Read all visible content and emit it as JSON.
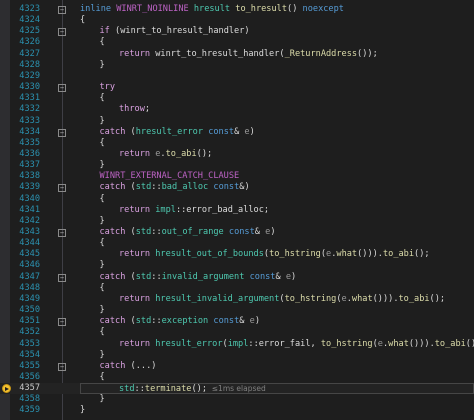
{
  "colors": {
    "keyword": "#569cd6",
    "control": "#d8a0df",
    "function": "#dcdcaa",
    "type": "#4ec9b0",
    "macro": "#bd63c5",
    "param": "#9a9a9a",
    "plain": "#dcdcdc",
    "line_number": "#2b91af"
  },
  "icons": {
    "fold_collapse": "−",
    "current_statement": "current-statement-arrow-icon"
  },
  "current_line": "4357",
  "perf_tip": "≤1ms elapsed",
  "lines": [
    {
      "num": "4323",
      "fold": true,
      "indent": 0,
      "tokens": [
        [
          "inline",
          "keyword"
        ],
        [
          " ",
          "plain"
        ],
        [
          "WINRT_NOINLINE",
          "macro"
        ],
        [
          " ",
          "plain"
        ],
        [
          "hresult",
          "type"
        ],
        [
          " ",
          "plain"
        ],
        [
          "to_hresult",
          "function"
        ],
        [
          "() ",
          "plain"
        ],
        [
          "noexcept",
          "keyword"
        ]
      ]
    },
    {
      "num": "4324",
      "fold": false,
      "indent": 0,
      "tokens": [
        [
          "{",
          "plain"
        ]
      ]
    },
    {
      "num": "4325",
      "fold": true,
      "indent": 1,
      "tokens": [
        [
          "if",
          "control"
        ],
        [
          " (",
          "plain"
        ],
        [
          "winrt_to_hresult_handler",
          "plain"
        ],
        [
          ")",
          "plain"
        ]
      ]
    },
    {
      "num": "4326",
      "fold": false,
      "indent": 1,
      "tokens": [
        [
          "{",
          "plain"
        ]
      ]
    },
    {
      "num": "4327",
      "fold": false,
      "indent": 2,
      "tokens": [
        [
          "return",
          "control"
        ],
        [
          " ",
          "plain"
        ],
        [
          "winrt_to_hresult_handler",
          "plain"
        ],
        [
          "(",
          "plain"
        ],
        [
          "_ReturnAddress",
          "function"
        ],
        [
          "());",
          "plain"
        ]
      ]
    },
    {
      "num": "4328",
      "fold": false,
      "indent": 1,
      "tokens": [
        [
          "}",
          "plain"
        ]
      ]
    },
    {
      "num": "4329",
      "fold": false,
      "indent": 0,
      "tokens": []
    },
    {
      "num": "4330",
      "fold": true,
      "indent": 1,
      "tokens": [
        [
          "try",
          "control"
        ]
      ]
    },
    {
      "num": "4331",
      "fold": false,
      "indent": 1,
      "tokens": [
        [
          "{",
          "plain"
        ]
      ]
    },
    {
      "num": "4332",
      "fold": false,
      "indent": 2,
      "tokens": [
        [
          "throw",
          "control"
        ],
        [
          ";",
          "plain"
        ]
      ]
    },
    {
      "num": "4333",
      "fold": false,
      "indent": 1,
      "tokens": [
        [
          "}",
          "plain"
        ]
      ]
    },
    {
      "num": "4334",
      "fold": true,
      "indent": 1,
      "tokens": [
        [
          "catch",
          "control"
        ],
        [
          " (",
          "plain"
        ],
        [
          "hresult_error",
          "type"
        ],
        [
          " ",
          "plain"
        ],
        [
          "const",
          "keyword"
        ],
        [
          "& ",
          "plain"
        ],
        [
          "e",
          "param"
        ],
        [
          ")",
          "plain"
        ]
      ]
    },
    {
      "num": "4335",
      "fold": false,
      "indent": 1,
      "tokens": [
        [
          "{",
          "plain"
        ]
      ]
    },
    {
      "num": "4336",
      "fold": false,
      "indent": 2,
      "tokens": [
        [
          "return",
          "control"
        ],
        [
          " ",
          "plain"
        ],
        [
          "e",
          "param"
        ],
        [
          ".",
          "plain"
        ],
        [
          "to_abi",
          "function"
        ],
        [
          "();",
          "plain"
        ]
      ]
    },
    {
      "num": "4337",
      "fold": false,
      "indent": 1,
      "tokens": [
        [
          "}",
          "plain"
        ]
      ]
    },
    {
      "num": "4338",
      "fold": false,
      "indent": 1,
      "tokens": [
        [
          "WINRT_EXTERNAL_CATCH_CLAUSE",
          "macro"
        ]
      ]
    },
    {
      "num": "4339",
      "fold": true,
      "indent": 1,
      "tokens": [
        [
          "catch",
          "control"
        ],
        [
          " (",
          "plain"
        ],
        [
          "std",
          "type"
        ],
        [
          "::",
          "plain"
        ],
        [
          "bad_alloc",
          "type"
        ],
        [
          " ",
          "plain"
        ],
        [
          "const",
          "keyword"
        ],
        [
          "&)",
          "plain"
        ]
      ]
    },
    {
      "num": "4340",
      "fold": false,
      "indent": 1,
      "tokens": [
        [
          "{",
          "plain"
        ]
      ]
    },
    {
      "num": "4341",
      "fold": false,
      "indent": 2,
      "tokens": [
        [
          "return",
          "control"
        ],
        [
          " ",
          "plain"
        ],
        [
          "impl",
          "type"
        ],
        [
          "::",
          "plain"
        ],
        [
          "error_bad_alloc",
          "plain"
        ],
        [
          ";",
          "plain"
        ]
      ]
    },
    {
      "num": "4342",
      "fold": false,
      "indent": 1,
      "tokens": [
        [
          "}",
          "plain"
        ]
      ]
    },
    {
      "num": "4343",
      "fold": true,
      "indent": 1,
      "tokens": [
        [
          "catch",
          "control"
        ],
        [
          " (",
          "plain"
        ],
        [
          "std",
          "type"
        ],
        [
          "::",
          "plain"
        ],
        [
          "out_of_range",
          "type"
        ],
        [
          " ",
          "plain"
        ],
        [
          "const",
          "keyword"
        ],
        [
          "& ",
          "plain"
        ],
        [
          "e",
          "param"
        ],
        [
          ")",
          "plain"
        ]
      ]
    },
    {
      "num": "4344",
      "fold": false,
      "indent": 1,
      "tokens": [
        [
          "{",
          "plain"
        ]
      ]
    },
    {
      "num": "4345",
      "fold": false,
      "indent": 2,
      "tokens": [
        [
          "return",
          "control"
        ],
        [
          " ",
          "plain"
        ],
        [
          "hresult_out_of_bounds",
          "type"
        ],
        [
          "(",
          "plain"
        ],
        [
          "to_hstring",
          "function"
        ],
        [
          "(",
          "plain"
        ],
        [
          "e",
          "param"
        ],
        [
          ".",
          "plain"
        ],
        [
          "what",
          "function"
        ],
        [
          "())).",
          "plain"
        ],
        [
          "to_abi",
          "function"
        ],
        [
          "();",
          "plain"
        ]
      ]
    },
    {
      "num": "4346",
      "fold": false,
      "indent": 1,
      "tokens": [
        [
          "}",
          "plain"
        ]
      ]
    },
    {
      "num": "4347",
      "fold": true,
      "indent": 1,
      "tokens": [
        [
          "catch",
          "control"
        ],
        [
          " (",
          "plain"
        ],
        [
          "std",
          "type"
        ],
        [
          "::",
          "plain"
        ],
        [
          "invalid_argument",
          "type"
        ],
        [
          " ",
          "plain"
        ],
        [
          "const",
          "keyword"
        ],
        [
          "& ",
          "plain"
        ],
        [
          "e",
          "param"
        ],
        [
          ")",
          "plain"
        ]
      ]
    },
    {
      "num": "4348",
      "fold": false,
      "indent": 1,
      "tokens": [
        [
          "{",
          "plain"
        ]
      ]
    },
    {
      "num": "4349",
      "fold": false,
      "indent": 2,
      "tokens": [
        [
          "return",
          "control"
        ],
        [
          " ",
          "plain"
        ],
        [
          "hresult_invalid_argument",
          "type"
        ],
        [
          "(",
          "plain"
        ],
        [
          "to_hstring",
          "function"
        ],
        [
          "(",
          "plain"
        ],
        [
          "e",
          "param"
        ],
        [
          ".",
          "plain"
        ],
        [
          "what",
          "function"
        ],
        [
          "())).",
          "plain"
        ],
        [
          "to_abi",
          "function"
        ],
        [
          "();",
          "plain"
        ]
      ]
    },
    {
      "num": "4350",
      "fold": false,
      "indent": 1,
      "tokens": [
        [
          "}",
          "plain"
        ]
      ]
    },
    {
      "num": "4351",
      "fold": true,
      "indent": 1,
      "tokens": [
        [
          "catch",
          "control"
        ],
        [
          " (",
          "plain"
        ],
        [
          "std",
          "type"
        ],
        [
          "::",
          "plain"
        ],
        [
          "exception",
          "type"
        ],
        [
          " ",
          "plain"
        ],
        [
          "const",
          "keyword"
        ],
        [
          "& ",
          "plain"
        ],
        [
          "e",
          "param"
        ],
        [
          ")",
          "plain"
        ]
      ]
    },
    {
      "num": "4352",
      "fold": false,
      "indent": 1,
      "tokens": [
        [
          "{",
          "plain"
        ]
      ]
    },
    {
      "num": "4353",
      "fold": false,
      "indent": 2,
      "tokens": [
        [
          "return",
          "control"
        ],
        [
          " ",
          "plain"
        ],
        [
          "hresult_error",
          "type"
        ],
        [
          "(",
          "plain"
        ],
        [
          "impl",
          "type"
        ],
        [
          "::",
          "plain"
        ],
        [
          "error_fail",
          "plain"
        ],
        [
          ", ",
          "plain"
        ],
        [
          "to_hstring",
          "function"
        ],
        [
          "(",
          "plain"
        ],
        [
          "e",
          "param"
        ],
        [
          ".",
          "plain"
        ],
        [
          "what",
          "function"
        ],
        [
          "())).",
          "plain"
        ],
        [
          "to_abi",
          "function"
        ],
        [
          "();",
          "plain"
        ]
      ]
    },
    {
      "num": "4354",
      "fold": false,
      "indent": 1,
      "tokens": [
        [
          "}",
          "plain"
        ]
      ]
    },
    {
      "num": "4355",
      "fold": true,
      "indent": 1,
      "tokens": [
        [
          "catch",
          "control"
        ],
        [
          " (...)",
          "plain"
        ]
      ]
    },
    {
      "num": "4356",
      "fold": false,
      "indent": 1,
      "tokens": [
        [
          "{",
          "plain"
        ]
      ]
    },
    {
      "num": "4357",
      "fold": false,
      "indent": 2,
      "current": true,
      "tokens": [
        [
          "std",
          "type"
        ],
        [
          "::",
          "plain"
        ],
        [
          "terminate",
          "function"
        ],
        [
          "();",
          "plain"
        ]
      ]
    },
    {
      "num": "4358",
      "fold": false,
      "indent": 1,
      "tokens": [
        [
          "}",
          "plain"
        ]
      ]
    },
    {
      "num": "4359",
      "fold": false,
      "indent": 0,
      "tokens": [
        [
          "}",
          "plain"
        ]
      ]
    }
  ]
}
